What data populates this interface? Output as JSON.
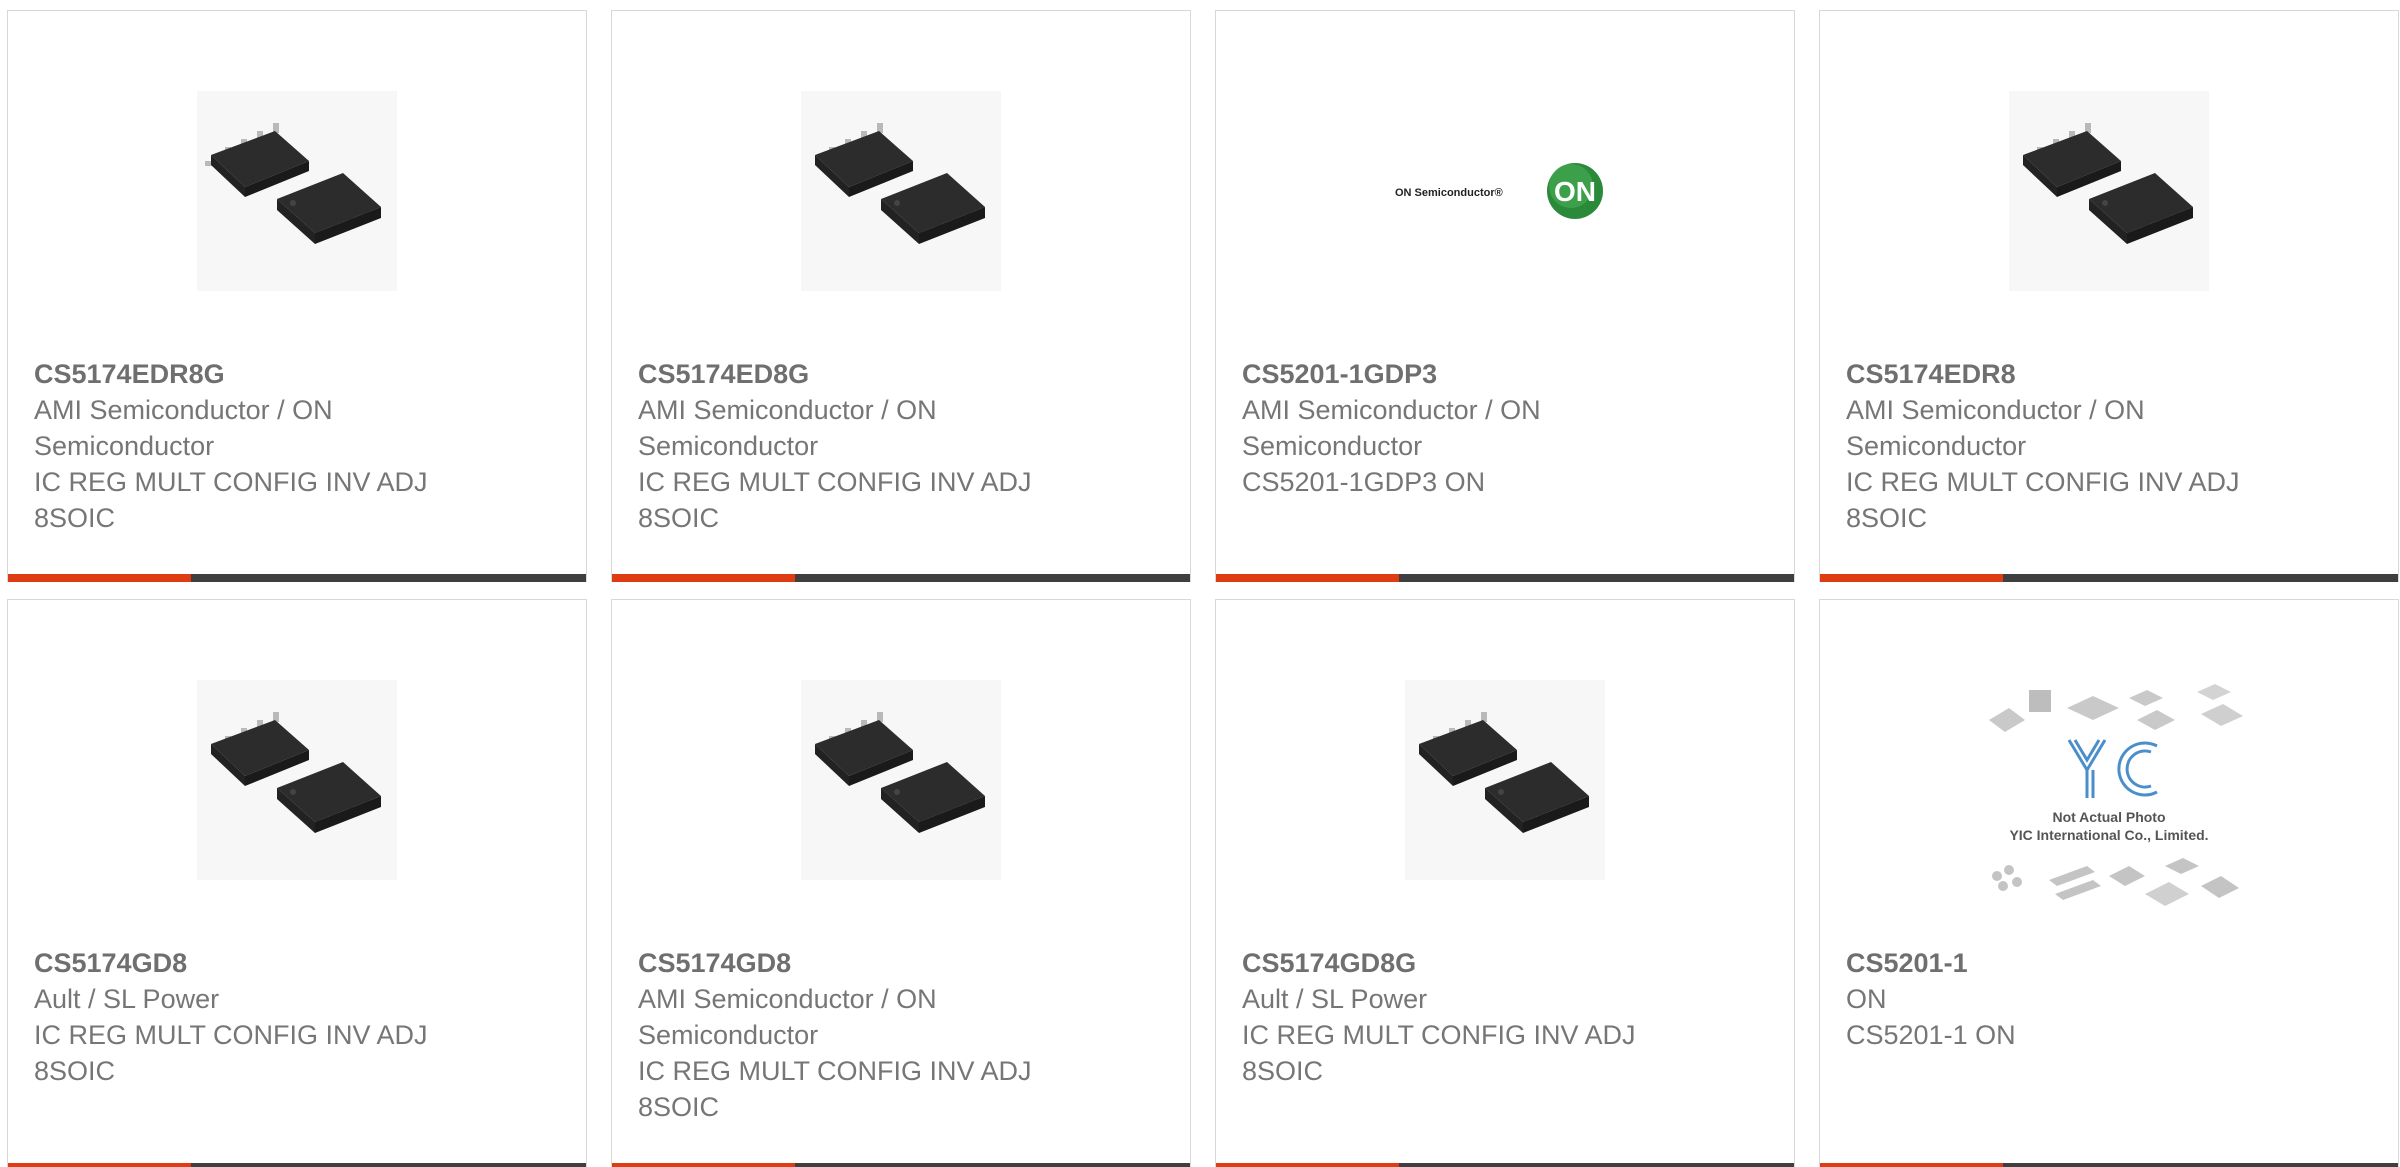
{
  "colors": {
    "accent": "#de3c12",
    "bar": "#3f3f3f",
    "text": "#767676",
    "border": "#d8d8d8"
  },
  "products": [
    {
      "part_number": "CS5174EDR8G",
      "manufacturer_line1": "AMI Semiconductor / ON",
      "manufacturer_line2": "Semiconductor",
      "description_line1": "IC REG MULT CONFIG INV ADJ",
      "description_line2": "8SOIC",
      "image": "soic8-chip-photo"
    },
    {
      "part_number": "CS5174ED8G",
      "manufacturer_line1": "AMI Semiconductor / ON",
      "manufacturer_line2": "Semiconductor",
      "description_line1": "IC REG MULT CONFIG INV ADJ",
      "description_line2": "8SOIC",
      "image": "soic8-chip-photo"
    },
    {
      "part_number": "CS5201-1GDP3",
      "manufacturer_line1": "AMI Semiconductor / ON",
      "manufacturer_line2": "Semiconductor",
      "description_line1": "CS5201-1GDP3 ON",
      "description_line2": "",
      "image": "on-semiconductor-logo",
      "logo_text": "ON Semiconductor®",
      "logo_badge": "ON"
    },
    {
      "part_number": "CS5174EDR8",
      "manufacturer_line1": "AMI Semiconductor / ON",
      "manufacturer_line2": "Semiconductor",
      "description_line1": "IC REG MULT CONFIG INV ADJ",
      "description_line2": "8SOIC",
      "image": "soic8-chip-photo"
    },
    {
      "part_number": "CS5174GD8",
      "manufacturer_line1": "Ault / SL Power",
      "manufacturer_line2": "IC REG MULT CONFIG INV ADJ",
      "description_line1": "8SOIC",
      "description_line2": "",
      "image": "soic8-chip-photo"
    },
    {
      "part_number": "CS5174GD8",
      "manufacturer_line1": "AMI Semiconductor / ON",
      "manufacturer_line2": "Semiconductor",
      "description_line1": "IC REG MULT CONFIG INV ADJ",
      "description_line2": "8SOIC",
      "image": "soic8-chip-photo"
    },
    {
      "part_number": "CS5174GD8G",
      "manufacturer_line1": "Ault / SL Power",
      "manufacturer_line2": "IC REG MULT CONFIG INV ADJ",
      "description_line1": "8SOIC",
      "description_line2": "",
      "image": "soic8-chip-photo"
    },
    {
      "part_number": "CS5201-1",
      "manufacturer_line1": "ON",
      "manufacturer_line2": "CS5201-1 ON",
      "description_line1": "",
      "description_line2": "",
      "image": "yic-not-actual-photo",
      "placeholder_logo": "YIC",
      "placeholder_line1": "Not Actual Photo",
      "placeholder_line2": "YIC International Co., Limited."
    }
  ]
}
